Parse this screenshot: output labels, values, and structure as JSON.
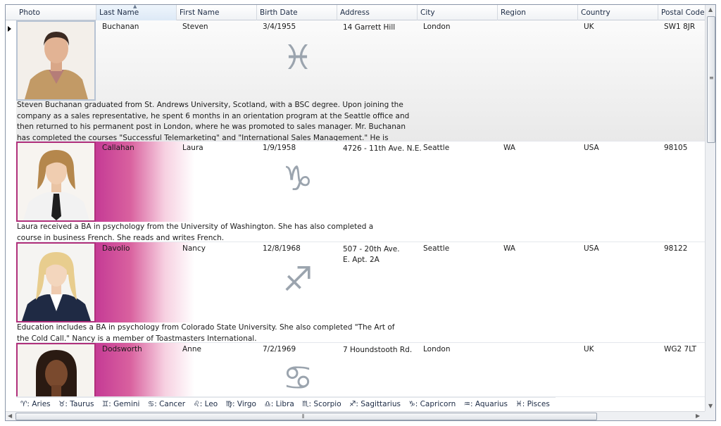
{
  "columns": [
    "Photo",
    "Last Name",
    "First Name",
    "Birth Date",
    "Address",
    "City",
    "Region",
    "Country",
    "Postal Code"
  ],
  "rows": [
    {
      "last_name": "Buchanan",
      "first_name": "Steven",
      "birth_date": "3/4/1955",
      "address": "14 Garrett Hill",
      "city": "London",
      "region": "",
      "country": "UK",
      "postal": "SW1 8JR",
      "zodiac": "♓",
      "notes": "Steven Buchanan graduated from St. Andrews University, Scotland, with a BSC degree.  Upon joining the company as a sales representative, he spent 6 months in an orientation program at the Seattle office and then returned to his permanent post in London, where he was promoted to sales manager.  Mr. Buchanan has completed the courses \"Successful Telemarketing\" and \"International Sales Management.\"  He is fluent in French."
    },
    {
      "last_name": "Callahan",
      "first_name": "Laura",
      "birth_date": "1/9/1958",
      "address": "4726 - 11th Ave. N.E.",
      "city": "Seattle",
      "region": "WA",
      "country": "USA",
      "postal": "98105",
      "zodiac": "♑",
      "notes": "Laura received a BA in psychology from the University of Washington.  She has also completed a course in business French.  She reads and writes French."
    },
    {
      "last_name": "Davolio",
      "first_name": "Nancy",
      "birth_date": "12/8/1968",
      "address": "507 - 20th Ave. E. Apt. 2A",
      "city": "Seattle",
      "region": "WA",
      "country": "USA",
      "postal": "98122",
      "zodiac": "♐",
      "notes": "Education includes a BA in psychology from Colorado State University.  She also completed \"The Art of the Cold Call.\"  Nancy is a member of Toastmasters International."
    },
    {
      "last_name": "Dodsworth",
      "first_name": "Anne",
      "birth_date": "7/2/1969",
      "address": "7 Houndstooth Rd.",
      "city": "London",
      "region": "",
      "country": "UK",
      "postal": "WG2 7LT",
      "zodiac": "♋",
      "notes": ""
    }
  ],
  "legend": [
    "♈: Aries",
    "♉: Taurus",
    "♊: Gemini",
    "♋: Cancer",
    "♌: Leo",
    "♍: Virgo",
    "♎: Libra",
    "♏: Scorpio",
    "♐: Sagittarius",
    "♑: Capricorn",
    "♒: Aquarius",
    "♓: Pisces"
  ],
  "icons": {
    "current_row": "row-indicator-arrow",
    "sort": "sort-ascending-icon"
  },
  "colors": {
    "accent": "#c53b95",
    "selection": "#e9e9e9",
    "border": "#8a96a8"
  }
}
